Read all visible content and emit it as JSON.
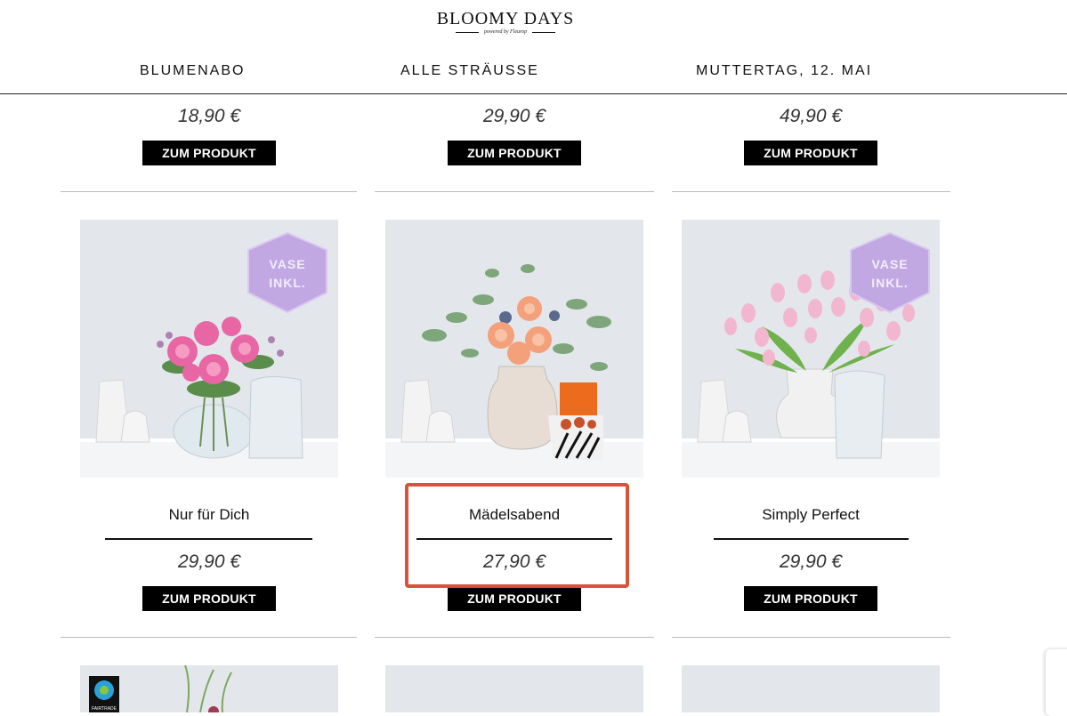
{
  "header": {
    "logo": "BLOOMY DAYS",
    "logo_sub": "powered by Fleurop",
    "nav": [
      "BLUMENABO",
      "ALLE STRÄUSSE",
      "MUTTERTAG, 12. MAI"
    ]
  },
  "row1": [
    {
      "price": "18,90 €",
      "button": "ZUM PRODUKT"
    },
    {
      "price": "29,90 €",
      "button": "ZUM PRODUKT"
    },
    {
      "price": "49,90 €",
      "button": "ZUM PRODUKT"
    }
  ],
  "row2": [
    {
      "name": "Nur für Dich",
      "price": "29,90 €",
      "button": "ZUM PRODUKT",
      "badge": "VASE INKL."
    },
    {
      "name": "Mädelsabend",
      "price": "27,90 €",
      "button": "ZUM PRODUKT"
    },
    {
      "name": "Simply Perfect",
      "price": "29,90 €",
      "button": "ZUM PRODUKT",
      "badge": "VASE INKL."
    }
  ],
  "row3": [
    {
      "badge": "FAIRTRADE"
    }
  ],
  "colors": {
    "accent_highlight": "#d9533a",
    "image_bg": "#e3e7ec",
    "badge_purple": "#c2a8e3"
  }
}
